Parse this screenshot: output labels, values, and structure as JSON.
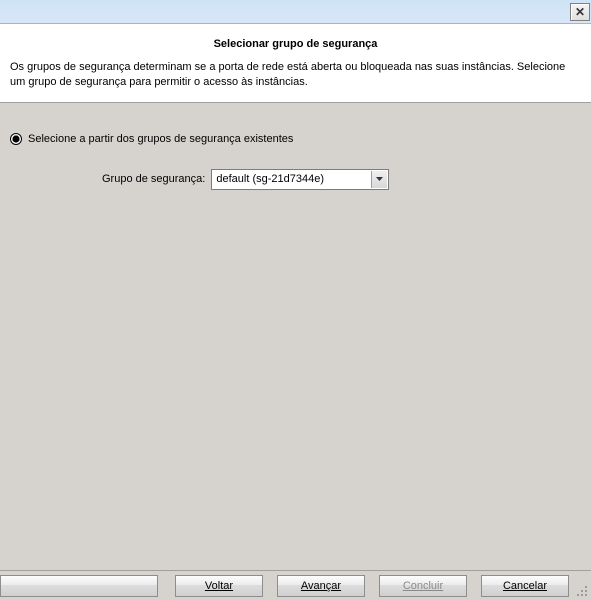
{
  "titlebar": {
    "close_glyph": "✕"
  },
  "header": {
    "title": "Selecionar grupo de segurança",
    "description": "Os grupos de segurança determinam se a porta de rede está aberta ou bloqueada nas suas instâncias. Selecione um grupo de segurança para permitir o acesso às instâncias."
  },
  "form": {
    "radio_existing_label": "Selecione a partir dos grupos de segurança existentes",
    "sg_label": "Grupo de segurança:",
    "sg_selected": "default (sg-21d7344e)"
  },
  "footer": {
    "back": "Voltar",
    "next": "Avançar",
    "finish": "Concluir",
    "cancel": "Cancelar"
  }
}
